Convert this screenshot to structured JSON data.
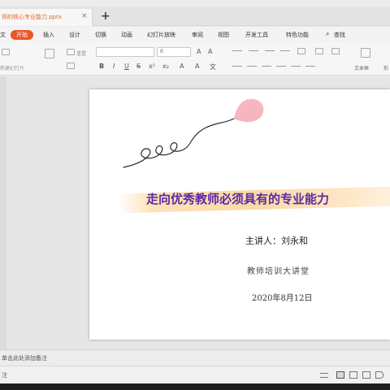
{
  "document_tab": {
    "filename": "师的核心专业能力.pptx",
    "close": "×",
    "new_tab": "+"
  },
  "menu": {
    "items": [
      "开始",
      "插入",
      "设计",
      "切换",
      "动画",
      "幻灯片放映",
      "审阅",
      "视图",
      "开发工具",
      "特色功能",
      "查找"
    ],
    "left_fragment": "文"
  },
  "ribbon": {
    "reset_label": "重置",
    "font_size": "0",
    "new_slide": "新建幻灯片",
    "textbox": "文本框",
    "shape_fragment": "形"
  },
  "slide": {
    "title": "走向优秀教师必须具有的专业能力",
    "presenter": "主讲人：刘永和",
    "venue": "教师培训大讲堂",
    "date": "2020年8月12日"
  },
  "notes": {
    "placeholder": "单击此处添加备注"
  },
  "statusbar": {
    "label": "注"
  },
  "colors": {
    "accent": "#e8572a",
    "title": "#5b2aa8",
    "band": "#fbd9a5",
    "balloon": "#f6a9b4"
  }
}
